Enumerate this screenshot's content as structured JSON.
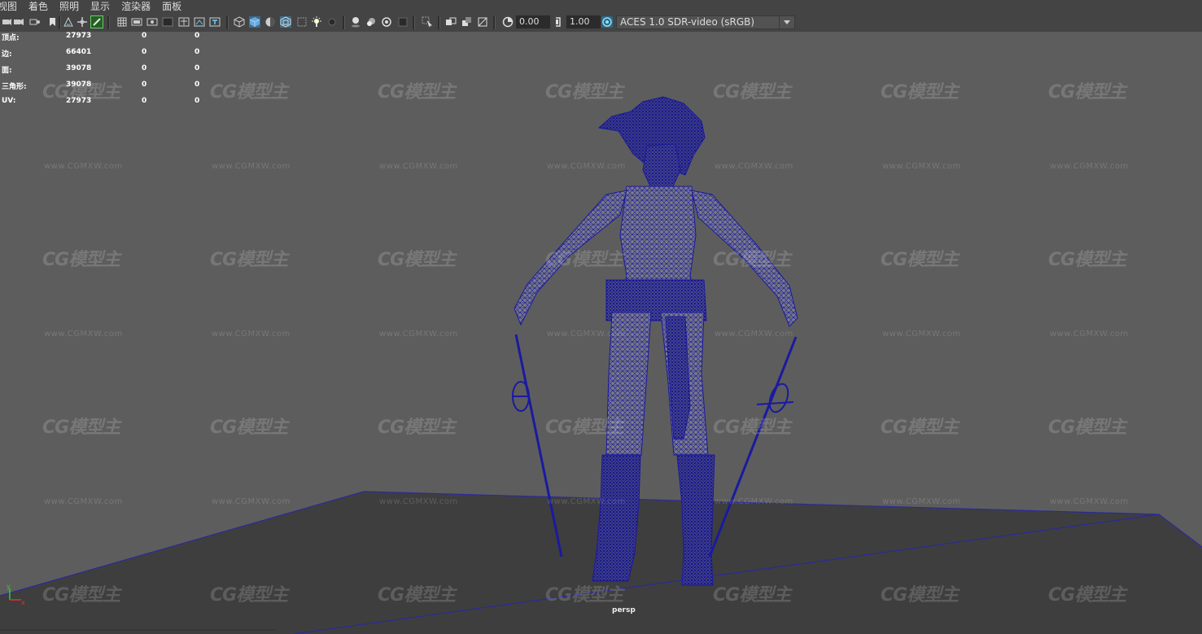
{
  "menubar": {
    "items": [
      "视图",
      "着色",
      "照明",
      "显示",
      "渲染器",
      "面板"
    ]
  },
  "toolbar": {
    "exposure_value": "0.00",
    "gamma_value": "1.00",
    "color_management": "ACES 1.0 SDR-video (sRGB)",
    "icons": [
      "camera-select-icon",
      "camera-attributes-icon",
      "bookmark-icon",
      "image-plane-icon",
      "pan-zoom-icon",
      "grease-pencil-icon",
      "grid-icon",
      "film-gate-icon",
      "resolution-gate-icon",
      "gate-mask-icon",
      "field-chart-icon",
      "safe-action-icon",
      "safe-title-icon",
      "wireframe-icon",
      "smooth-shade-icon",
      "wireframe-on-shaded-icon",
      "textured-icon",
      "use-lights-icon",
      "shadows-icon",
      "screen-space-ao-icon",
      "motion-blur-icon",
      "multisample-aa-icon",
      "depth-of-field-icon",
      "isolate-select-icon",
      "xray-icon",
      "xray-active-icon",
      "xray-joints-icon",
      "backface-icon",
      "exposure-icon",
      "gamma-icon",
      "color-management-icon"
    ]
  },
  "hud": {
    "rows": [
      {
        "label": "顶点:",
        "c1": "27973",
        "c2": "0",
        "c3": "0"
      },
      {
        "label": "边:",
        "c1": "66401",
        "c2": "0",
        "c3": "0"
      },
      {
        "label": "面:",
        "c1": "39078",
        "c2": "0",
        "c3": "0"
      },
      {
        "label": "三角形:",
        "c1": "39078",
        "c2": "0",
        "c3": "0"
      },
      {
        "label": "UV:",
        "c1": "27973",
        "c2": "0",
        "c3": "0"
      }
    ]
  },
  "viewport": {
    "camera": "persp",
    "watermark_logo": "CG模型主",
    "watermark_url": "www.CGMXW.com",
    "wire_color": "#1a1aa0",
    "background_color": "#5d5d5d",
    "ground_color": "#3d3d3d"
  },
  "axis": {
    "y": "y",
    "x": "x"
  }
}
